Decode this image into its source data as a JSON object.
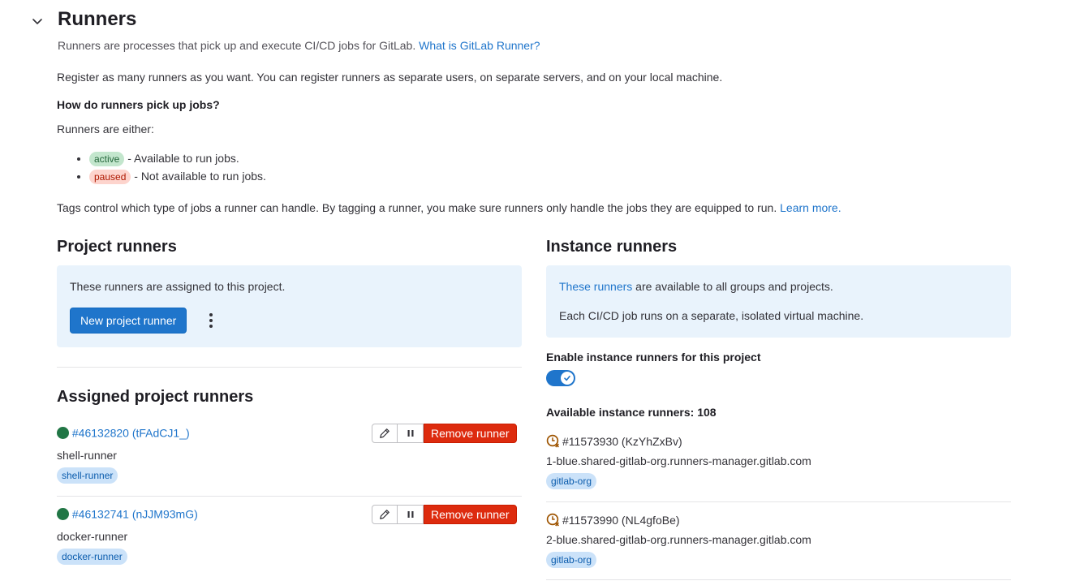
{
  "header": {
    "title": "Runners",
    "intro_text": "Runners are processes that pick up and execute CI/CD jobs for GitLab.",
    "intro_link": "What is GitLab Runner?"
  },
  "body": {
    "register_text": "Register as many runners as you want. You can register runners as separate users, on separate servers, and on your local machine.",
    "how_heading": "How do runners pick up jobs?",
    "either_text": "Runners are either:",
    "states": [
      {
        "badge": "active",
        "desc": " - Available to run jobs."
      },
      {
        "badge": "paused",
        "desc": " - Not available to run jobs."
      }
    ],
    "tags_text": "Tags control which type of jobs a runner can handle. By tagging a runner, you make sure runners only handle the jobs they are equipped to run.",
    "tags_link": "Learn more."
  },
  "project_runners": {
    "title": "Project runners",
    "info_text": "These runners are assigned to this project.",
    "new_button": "New project runner",
    "assigned_title": "Assigned project runners",
    "remove_label": "Remove runner",
    "runners": [
      {
        "id": "#46132820 (tFAdCJ1_)",
        "name": "shell-runner",
        "tag": "shell-runner"
      },
      {
        "id": "#46132741 (nJJM93mG)",
        "name": "docker-runner",
        "tag": "docker-runner"
      }
    ]
  },
  "instance_runners": {
    "title": "Instance runners",
    "info_link": "These runners",
    "info_text": " are available to all groups and projects.",
    "info_text2": "Each CI/CD job runs on a separate, isolated virtual machine.",
    "enable_label": "Enable instance runners for this project",
    "enabled": true,
    "available_label": "Available instance runners: 108",
    "runners": [
      {
        "id": "#11573930 (KzYhZxBv)",
        "host": "1-blue.shared-gitlab-org.runners-manager.gitlab.com",
        "tag": "gitlab-org"
      },
      {
        "id": "#11573990 (NL4gfoBe)",
        "host": "2-blue.shared-gitlab-org.runners-manager.gitlab.com",
        "tag": "gitlab-org"
      }
    ]
  },
  "colors": {
    "link": "#1f75cb",
    "primary": "#1f75cb",
    "danger": "#dd2b0e",
    "online": "#217645",
    "stale": "#9e5400"
  }
}
